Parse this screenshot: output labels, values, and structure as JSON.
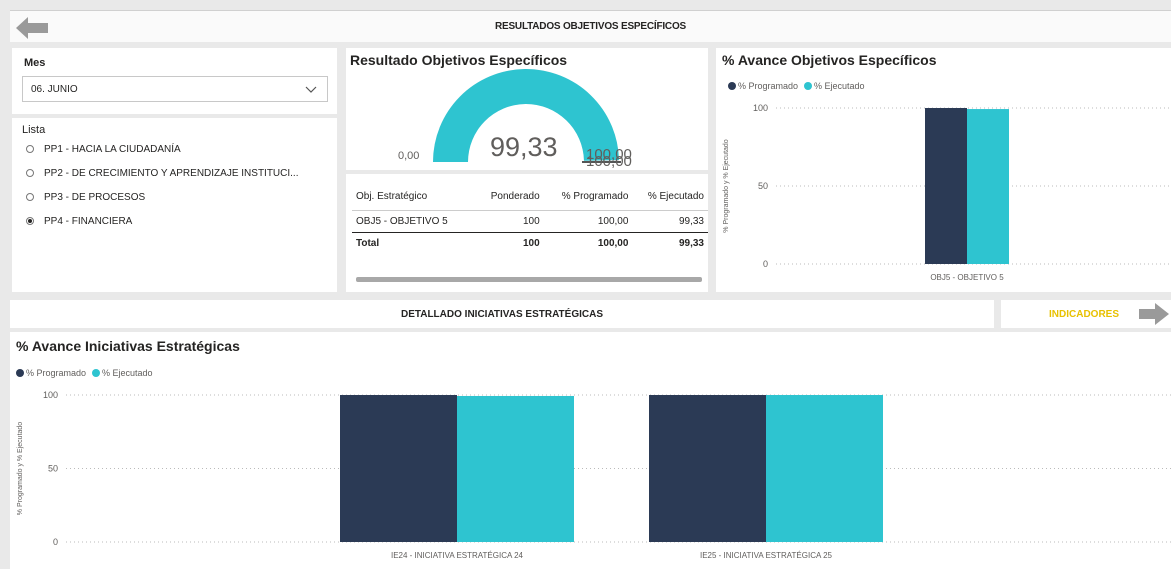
{
  "header": {
    "title": "RESULTADOS OBJETIVOS ESPECÍFICOS"
  },
  "slicer_mes": {
    "label": "Mes",
    "value": "06. JUNIO"
  },
  "slicer_lista": {
    "label": "Lista",
    "options": [
      {
        "label": "PP1 - HACIA LA CIUDADANÍA",
        "selected": false
      },
      {
        "label": "PP2 - DE CRECIMIENTO Y APRENDIZAJE INSTITUCI...",
        "selected": false
      },
      {
        "label": "PP3 - DE PROCESOS",
        "selected": false
      },
      {
        "label": "PP4 - FINANCIERA",
        "selected": true
      }
    ]
  },
  "gauge": {
    "title": "Resultado Objetivos Específicos",
    "min_label": "0,00",
    "value_label": "99,33",
    "max_label": "100,00",
    "target_label": "100,00",
    "value": 99.33,
    "min": 0,
    "max": 100,
    "color": "#2ec4d0"
  },
  "table": {
    "headers": [
      "Obj. Estratégico",
      "Ponderado",
      "% Programado",
      "% Ejecutado"
    ],
    "rows": [
      [
        "OBJ5 - OBJETIVO 5",
        "100",
        "100,00",
        "99,33"
      ]
    ],
    "total": [
      "Total",
      "100",
      "100,00",
      "99,33"
    ]
  },
  "section2": {
    "title": "DETALLADO INICIATIVAS ESTRATÉGICAS"
  },
  "indicadores_button": {
    "label": "INDICADORES"
  },
  "colors": {
    "programado": "#2b3a55",
    "ejecutado": "#2ec4d0",
    "accent": "#e8c100"
  },
  "chart_data": [
    {
      "type": "bar",
      "title": "% Avance Objetivos Específicos",
      "ylabel": "% Programado y % Ejecutado",
      "ylim": [
        0,
        100
      ],
      "yticks": [
        0,
        50,
        100
      ],
      "categories": [
        "OBJ5 - OBJETIVO 5"
      ],
      "series": [
        {
          "name": "% Programado",
          "values": [
            100
          ]
        },
        {
          "name": "% Ejecutado",
          "values": [
            99.33
          ]
        }
      ],
      "legend": "top-left",
      "grid": true
    },
    {
      "type": "bar",
      "title": "% Avance Iniciativas Estratégicas",
      "ylabel": "% Programado y % Ejecutado",
      "ylim": [
        0,
        100
      ],
      "yticks": [
        0,
        50,
        100
      ],
      "categories": [
        "IE24 - INICIATIVA ESTRATÉGICA 24",
        "IE25 - INICIATIVA ESTRATÉGICA 25"
      ],
      "series": [
        {
          "name": "% Programado",
          "values": [
            100,
            100
          ]
        },
        {
          "name": "% Ejecutado",
          "values": [
            99.33,
            100
          ]
        }
      ],
      "legend": "top-left",
      "grid": true
    }
  ]
}
